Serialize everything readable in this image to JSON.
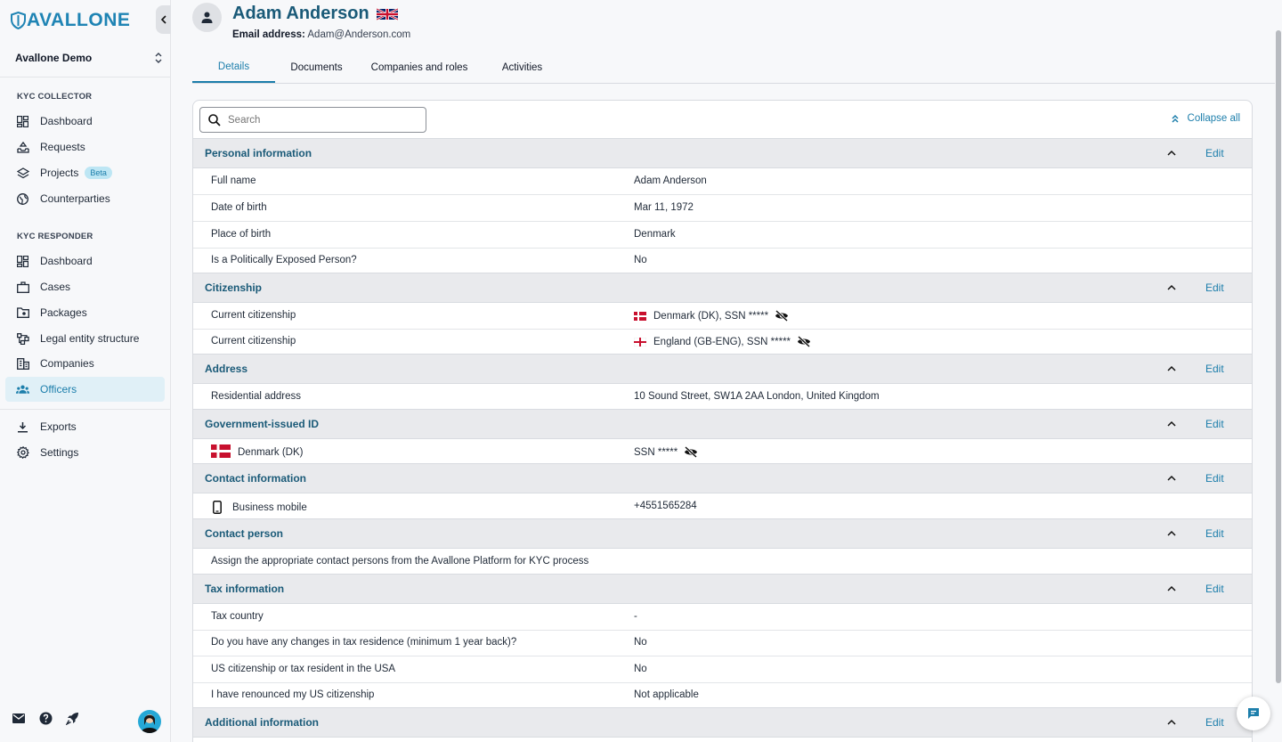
{
  "app": {
    "brand": "AVALLONE",
    "organization": "Avallone Demo"
  },
  "sidebar": {
    "collector_label": "KYC COLLECTOR",
    "collector_items": [
      {
        "label": "Dashboard",
        "icon": "dashboard-icon"
      },
      {
        "label": "Requests",
        "icon": "inbox-icon"
      },
      {
        "label": "Projects",
        "icon": "layers-icon",
        "badge": "Beta"
      },
      {
        "label": "Counterparties",
        "icon": "globe-icon"
      }
    ],
    "responder_label": "KYC RESPONDER",
    "responder_items": [
      {
        "label": "Dashboard",
        "icon": "dashboard-icon"
      },
      {
        "label": "Cases",
        "icon": "briefcase-icon"
      },
      {
        "label": "Packages",
        "icon": "folder-icon"
      },
      {
        "label": "Legal entity structure",
        "icon": "structure-icon"
      },
      {
        "label": "Companies",
        "icon": "building-icon"
      },
      {
        "label": "Officers",
        "icon": "people-icon",
        "active": true
      }
    ],
    "other_items": [
      {
        "label": "Exports",
        "icon": "download-icon"
      },
      {
        "label": "Settings",
        "icon": "gear-icon"
      }
    ]
  },
  "person": {
    "name": "Adam Anderson",
    "email_label": "Email address:",
    "email": "Adam@Anderson.com"
  },
  "tabs": [
    "Details",
    "Documents",
    "Companies and roles",
    "Activities"
  ],
  "search": {
    "placeholder": "Search"
  },
  "collapse_all": "Collapse all",
  "edit_label": "Edit",
  "sections": {
    "personal": {
      "title": "Personal information",
      "rows": [
        {
          "label": "Full name",
          "value": "Adam Anderson"
        },
        {
          "label": "Date of birth",
          "value": "Mar 11, 1972"
        },
        {
          "label": "Place of birth",
          "value": "Denmark"
        },
        {
          "label": "Is a Politically Exposed Person?",
          "value": "No"
        }
      ]
    },
    "citizenship": {
      "title": "Citizenship",
      "rows": [
        {
          "label": "Current citizenship",
          "value": "Denmark (DK), SSN *****"
        },
        {
          "label": "Current citizenship",
          "value": "England (GB-ENG), SSN *****"
        }
      ]
    },
    "address": {
      "title": "Address",
      "rows": [
        {
          "label": "Residential address",
          "value": "10 Sound Street, SW1A 2AA London, United Kingdom"
        }
      ]
    },
    "gov_id": {
      "title": "Government-issued ID",
      "rows": [
        {
          "label": "Denmark (DK)",
          "value": "SSN *****"
        }
      ]
    },
    "contact_info": {
      "title": "Contact information",
      "rows": [
        {
          "label": "Business mobile",
          "value": "+4551565284"
        }
      ]
    },
    "contact_person": {
      "title": "Contact person",
      "text": "Assign the appropriate contact persons from the Avallone Platform for KYC process"
    },
    "tax": {
      "title": "Tax information",
      "rows": [
        {
          "label": "Tax country",
          "value": "-"
        },
        {
          "label": "Do you have any changes in tax residence (minimum 1 year back)?",
          "value": "No"
        },
        {
          "label": "US citizenship or tax resident in the USA",
          "value": "No"
        },
        {
          "label": "I have renounced my US citizenship",
          "value": "Not applicable"
        }
      ]
    },
    "additional": {
      "title": "Additional information"
    }
  },
  "colors": {
    "accent": "#1c7eab",
    "heading": "#1a5a78",
    "danish_red": "#c8102e"
  }
}
